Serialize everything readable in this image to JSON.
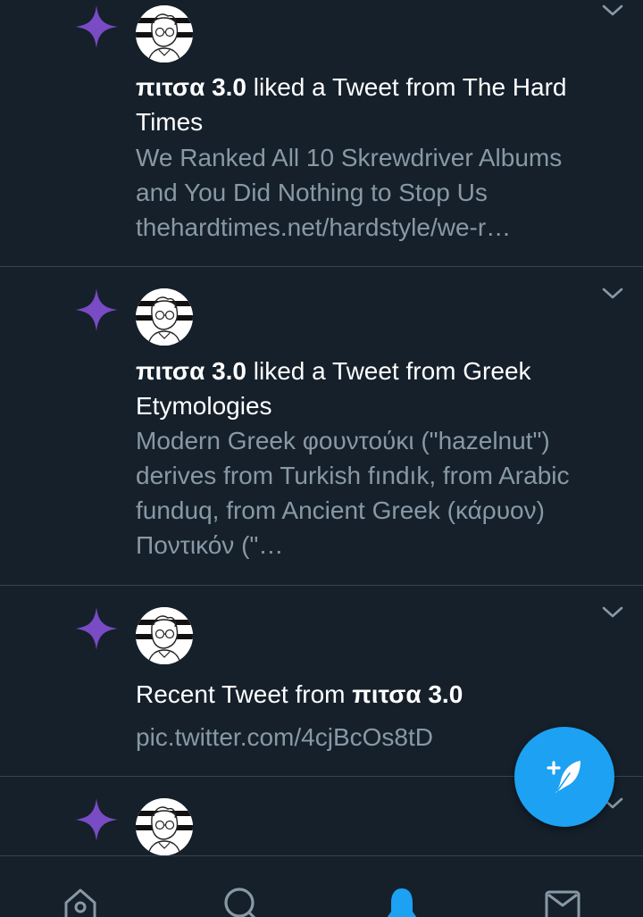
{
  "notifications": [
    {
      "icon": "sparkle-icon",
      "actor_name": "πιτσα 3.0",
      "action_text": " liked a Tweet from The Hard Times",
      "preview": "We Ranked All 10 Skrewdriver Albums and You Did Nothing to Stop Us thehardtimes.net/hardstyle/we-r…"
    },
    {
      "icon": "sparkle-icon",
      "actor_name": "πιτσα 3.0",
      "action_text": " liked a Tweet from Greek Etymologies",
      "preview": "Modern Greek φουντούκι (\"hazelnut\") derives from Turkish fındık, from Arabic funduq, from Ancient Greek (κάρυον) Ποντικόν (\"…"
    },
    {
      "icon": "sparkle-icon",
      "prefix_text": "Recent Tweet from ",
      "actor_name": "πιτσα 3.0",
      "preview": "pic.twitter.com/4cjBcOs8tD"
    },
    {
      "icon": "sparkle-icon"
    }
  ],
  "compose_button": {
    "icon": "compose-tweet-icon"
  },
  "bottom_nav": [
    {
      "id": "home",
      "icon": "home-icon"
    },
    {
      "id": "search",
      "icon": "search-icon"
    },
    {
      "id": "notifications",
      "icon": "bell-icon",
      "active": true
    },
    {
      "id": "messages",
      "icon": "mail-icon"
    }
  ],
  "colors": {
    "background": "#15202b",
    "divider": "#38444d",
    "primary_text": "#ffffff",
    "secondary_text": "#8899a6",
    "sparkle": "#794bc4",
    "accent": "#1da1f2"
  }
}
